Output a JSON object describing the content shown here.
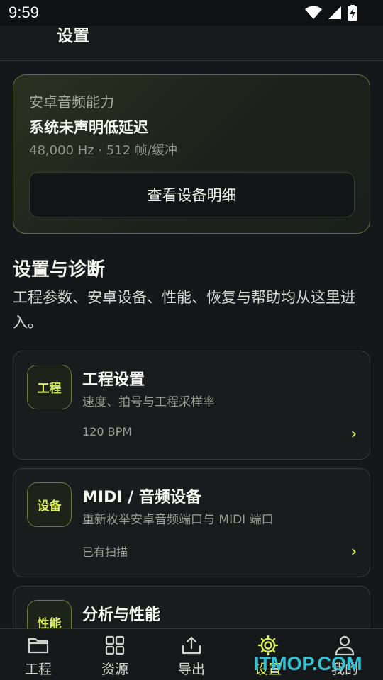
{
  "status_bar": {
    "time": "9:59",
    "icons": [
      "wifi-icon",
      "signal-icon",
      "battery-charging-icon"
    ]
  },
  "app_bar": {
    "title": "设置"
  },
  "audio_card": {
    "caption": "安卓音频能力",
    "status": "系统未声明低延迟",
    "spec": "48,000 Hz · 512 帧/缓冲",
    "button_label": "查看设备明细"
  },
  "section": {
    "title": "设置与诊断",
    "description": "工程参数、安卓设备、性能、恢复与帮助均从这里进入。"
  },
  "menu": [
    {
      "badge": "工程",
      "title": "工程设置",
      "subtitle": "速度、拍号与工程采样率",
      "meta": "120 BPM",
      "chevron": "›"
    },
    {
      "badge": "设备",
      "title": "MIDI / 音频设备",
      "subtitle": "重新枚举安卓音频端口与 MIDI 端口",
      "meta": "已有扫描",
      "chevron": "›"
    },
    {
      "badge": "性能",
      "title": "分析与性能",
      "subtitle": "",
      "meta": "",
      "chevron": ""
    }
  ],
  "bottom_nav": [
    {
      "label": "工程",
      "icon": "folder-icon",
      "active": false
    },
    {
      "label": "资源",
      "icon": "grid-icon",
      "active": false
    },
    {
      "label": "导出",
      "icon": "upload-icon",
      "active": false
    },
    {
      "label": "设置",
      "icon": "gear-icon",
      "active": true
    },
    {
      "label": "我的",
      "icon": "user-icon",
      "active": false
    }
  ],
  "colors": {
    "accent": "#d8ec5c",
    "background": "#14181a",
    "card": "#181c1d",
    "watermark": "#37c3d6"
  },
  "watermark": "ITMOP.COM"
}
